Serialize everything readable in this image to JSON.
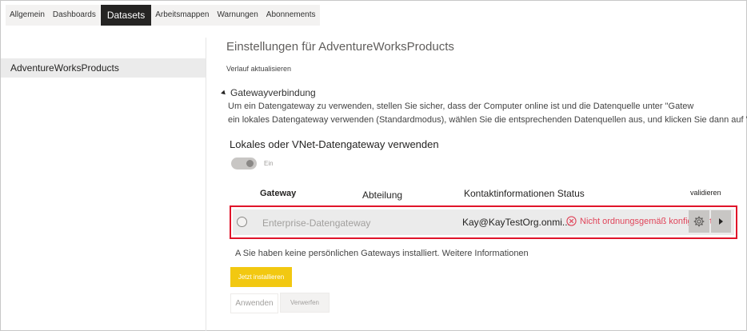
{
  "tabs": [
    {
      "label": "Allgemein",
      "active": false
    },
    {
      "label": "Dashboards",
      "active": false
    },
    {
      "label": "Datasets",
      "active": true
    },
    {
      "label": "Arbeitsmappen",
      "active": false
    },
    {
      "label": "Warnungen",
      "active": false
    },
    {
      "label": "Abonnements",
      "active": false
    }
  ],
  "sidebar": {
    "items": [
      {
        "label": "AdventureWorksProducts",
        "selected": true
      }
    ]
  },
  "main": {
    "title": "Einstellungen für AdventureWorksProducts",
    "refresh_history": "Verlauf aktualisieren",
    "gateway_section": {
      "heading": "Gatewayverbindung",
      "description_line1": "Um ein Datengateway zu verwenden, stellen Sie sicher, dass der Computer online ist und die Datenquelle unter \"Gatew",
      "description_line2": "ein lokales Datengateway verwenden (Standardmodus), wählen Sie die entsprechenden Datenquellen aus, und klicken Sie dann auf \"A",
      "use_gateway_label": "Lokales oder VNet-Datengateway verwenden",
      "toggle_label": "Ein",
      "columns": {
        "gateway": "Gateway",
        "department": "Abteilung",
        "contact_status": "Kontaktinformationen Status",
        "validate": "validieren"
      },
      "row": {
        "name": "Enterprise-Datengateway",
        "contact": "Kay@KayTestOrg.onmi...",
        "status": "Nicht ordnungsgemäß konfiguriert"
      },
      "note": "A Sie haben keine persönlichen Gateways installiert. Weitere Informationen"
    },
    "buttons": {
      "install": "Jetzt installieren",
      "apply": "Anwenden",
      "discard": "Verwerfen"
    }
  },
  "colors": {
    "accent_yellow": "#f2c811",
    "error_red": "#e0142a",
    "active_tab": "#252423"
  }
}
